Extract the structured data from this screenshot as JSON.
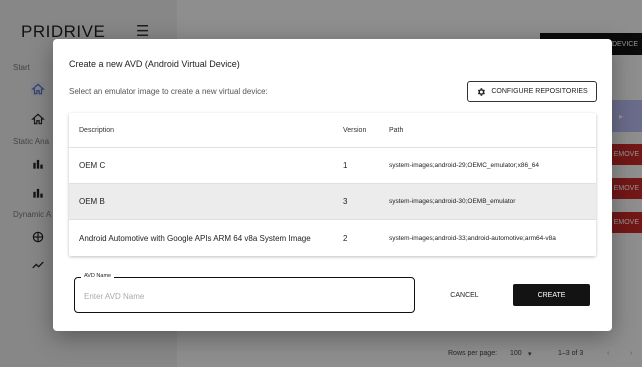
{
  "app": {
    "brand": "PRIDRIVE",
    "sections": {
      "start": "Start",
      "static": "Static Ana",
      "dynamic": "Dynamic A"
    },
    "header_button": "DEVICE",
    "remove_label": "EMOVE",
    "footer": {
      "rows_per_page_label": "Rows per page:",
      "rows_per_page_value": "100",
      "range": "1–3 of 3"
    }
  },
  "dialog": {
    "title": "Create a new AVD (Android Virtual Device)",
    "subtitle": "Select an emulator image to create a new virtual device:",
    "configure_label": "CONFIGURE REPOSITORIES",
    "table": {
      "headers": {
        "description": "Description",
        "version": "Version",
        "path": "Path"
      },
      "rows": [
        {
          "description": "OEM C",
          "version": "1",
          "path": "system-images;android-29;OEMC_emulator;x86_64"
        },
        {
          "description": "OEM B",
          "version": "3",
          "path": "system-images;android-30;OEMB_emulator"
        },
        {
          "description": "Android Automotive with Google APIs ARM 64 v8a System Image",
          "version": "2",
          "path": "system-images;android-33;android-automotive;arm64-v8a"
        }
      ]
    },
    "avd_name": {
      "label": "AVD Name",
      "placeholder": "Enter AVD Name",
      "value": ""
    },
    "cancel_label": "CANCEL",
    "create_label": "CREATE"
  },
  "colors": {
    "primary_dark": "#131313",
    "danger": "#c62828",
    "accent_light": "#b7bbef"
  },
  "icons": {
    "menu": "hamburger-icon",
    "home": "home-icon",
    "chart": "bar-chart-icon",
    "compass": "compass-icon",
    "trend": "trend-icon",
    "settings": "gear-icon",
    "dropdown": "caret-down-icon",
    "prev": "chevron-left-icon",
    "next": "chevron-right-icon"
  }
}
